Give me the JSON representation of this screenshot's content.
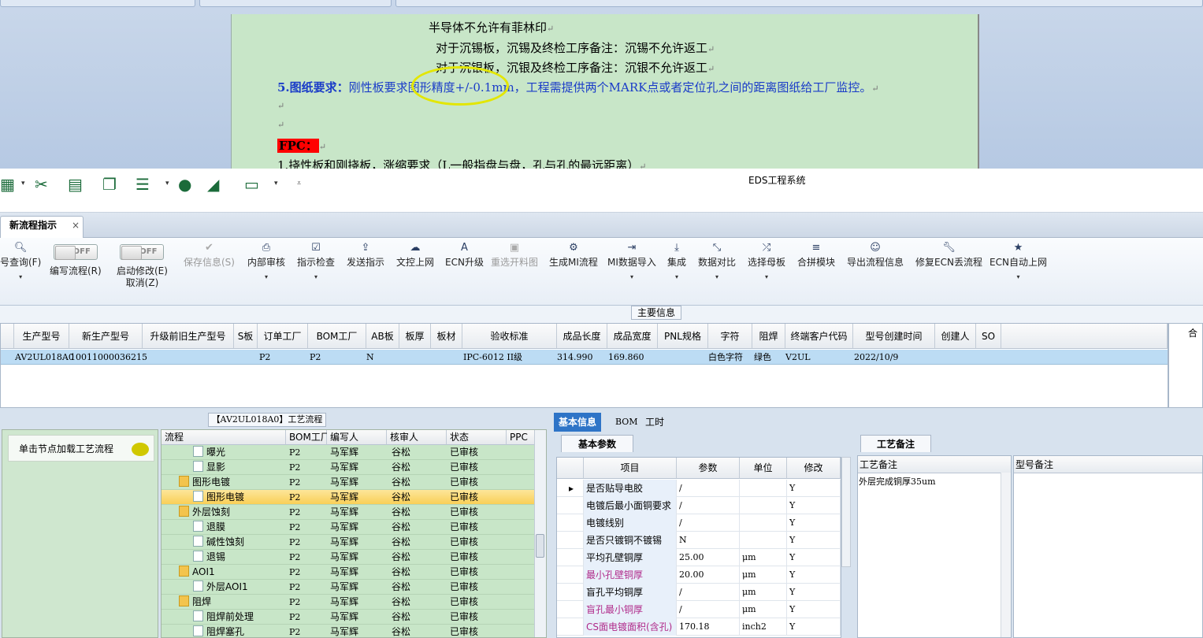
{
  "word": {
    "lines": [
      "半导体不允许有菲林印",
      "对于沉锡板，沉锡及终检工序备注：沉锡不允许返工",
      "对于沉银板，沉银及终检工序备注：沉银不允许返工"
    ],
    "req_label": "5.图纸要求：",
    "req_text": "刚性板要求图形精度+/-0.1mm，工程需提供两个MARK点或者定位孔之间的距离图纸给工厂监控。",
    "fpc": "FPC：",
    "fpc_line": "1.挠性板和刚挠板，涨缩要求（L一般指盘与盘，孔与孔的最远距离）"
  },
  "app": {
    "title": "EDS工程系统"
  },
  "tab": {
    "label": "新流程指示",
    "close": "×"
  },
  "ribbon": {
    "query": "号查询(F)",
    "edit_flow": "编写流程(R)",
    "start_modify": "启动修改(E)",
    "cancel": "取消(Z)",
    "toggle_off": "OFF",
    "save": "保存信息(S)",
    "internal_review": "内部审核",
    "instr_check": "指示检查",
    "send": "发送指示",
    "doc_upload": "文控上网",
    "ecn_upgrade": "ECN升级",
    "reselect_img": "重选开料图",
    "gen_mi": "生成MI流程",
    "mi_import": "MI数据导入",
    "integrate": "集成",
    "compare": "数据对比",
    "choose_board": "选择母板",
    "merge_module": "合拼模块",
    "export_info": "导出流程信息",
    "fix_ecn": "修复ECN丢流程",
    "ecn_auto": "ECN自动上网"
  },
  "main_info": {
    "label": "主要信息",
    "columns": [
      "生产型号",
      "新生产型号",
      "升级前旧生产型号",
      "S板",
      "订单工厂",
      "BOM工厂",
      "AB板",
      "板厚",
      "板材",
      "验收标准",
      "成品长度",
      "成品宽度",
      "PNL规格",
      "字符",
      "阻焊",
      "终端客户代码",
      "型号创建时间",
      "创建人",
      "SO"
    ],
    "row": {
      "c0": "AV2UL018A0",
      "c1": "10011000036215",
      "c4": "P2",
      "c5": "P2",
      "c6": "N",
      "c9": "IPC-6012 II级",
      "c10": "314.990",
      "c11": "169.860",
      "c13": "白色字符",
      "c14": "绿色",
      "c15": "V2UL",
      "c16": "2022/10/9"
    },
    "right_header": "合"
  },
  "process": {
    "title": "【AV2UL018A0】工艺流程",
    "node_hint": "单击节点加载工艺流程",
    "columns": [
      "流程",
      "BOM工厂",
      "编写人",
      "核审人",
      "状态",
      "PPC"
    ],
    "rows": [
      {
        "name": "曝光",
        "type": "doc",
        "indent": 2,
        "bom": "P2",
        "writer": "马军辉",
        "reviewer": "谷松",
        "status": "已审核"
      },
      {
        "name": "显影",
        "type": "doc",
        "indent": 2,
        "bom": "P2",
        "writer": "马军辉",
        "reviewer": "谷松",
        "status": "已审核"
      },
      {
        "name": "图形电镀",
        "type": "folder",
        "indent": 1,
        "bom": "P2",
        "writer": "马军辉",
        "reviewer": "谷松",
        "status": "已审核"
      },
      {
        "name": "图形电镀",
        "type": "doc",
        "indent": 2,
        "bom": "P2",
        "writer": "马军辉",
        "reviewer": "谷松",
        "status": "已审核",
        "selected": true
      },
      {
        "name": "外层蚀刻",
        "type": "folder",
        "indent": 1,
        "bom": "P2",
        "writer": "马军辉",
        "reviewer": "谷松",
        "status": "已审核"
      },
      {
        "name": "退膜",
        "type": "doc",
        "indent": 2,
        "bom": "P2",
        "writer": "马军辉",
        "reviewer": "谷松",
        "status": "已审核"
      },
      {
        "name": "碱性蚀刻",
        "type": "doc",
        "indent": 2,
        "bom": "P2",
        "writer": "马军辉",
        "reviewer": "谷松",
        "status": "已审核"
      },
      {
        "name": "退锡",
        "type": "doc",
        "indent": 2,
        "bom": "P2",
        "writer": "马军辉",
        "reviewer": "谷松",
        "status": "已审核"
      },
      {
        "name": "AOI1",
        "type": "folder",
        "indent": 1,
        "bom": "P2",
        "writer": "马军辉",
        "reviewer": "谷松",
        "status": "已审核"
      },
      {
        "name": "外层AOI1",
        "type": "doc",
        "indent": 2,
        "bom": "P2",
        "writer": "马军辉",
        "reviewer": "谷松",
        "status": "已审核"
      },
      {
        "name": "阻焊",
        "type": "folder",
        "indent": 1,
        "bom": "P2",
        "writer": "马军辉",
        "reviewer": "谷松",
        "status": "已审核"
      },
      {
        "name": "阻焊前处理",
        "type": "doc",
        "indent": 2,
        "bom": "P2",
        "writer": "马军辉",
        "reviewer": "谷松",
        "status": "已审核"
      },
      {
        "name": "阻焊塞孔",
        "type": "doc",
        "indent": 2,
        "bom": "P2",
        "writer": "马军辉",
        "reviewer": "谷松",
        "status": "已审核"
      }
    ]
  },
  "basic": {
    "tabs": [
      "基本信息",
      "BOM",
      "工时"
    ],
    "section": "基本参数",
    "columns": [
      "项目",
      "参数",
      "单位",
      "修改"
    ],
    "rows": [
      {
        "item": "是否贴导电胶",
        "value": "/",
        "unit": "",
        "mod": "Y",
        "pink": false
      },
      {
        "item": "电镀后最小面铜要求",
        "value": "/",
        "unit": "",
        "mod": "Y",
        "pink": false
      },
      {
        "item": "电镀线别",
        "value": "/",
        "unit": "",
        "mod": "Y",
        "pink": false
      },
      {
        "item": "是否只镀铜不镀锡",
        "value": "N",
        "unit": "",
        "mod": "Y",
        "pink": false
      },
      {
        "item": "平均孔壁铜厚",
        "value": "25.00",
        "unit": "μm",
        "mod": "Y",
        "pink": false
      },
      {
        "item": "最小孔壁铜厚",
        "value": "20.00",
        "unit": "μm",
        "mod": "Y",
        "pink": true
      },
      {
        "item": "盲孔平均铜厚",
        "value": "/",
        "unit": "μm",
        "mod": "Y",
        "pink": false
      },
      {
        "item": "盲孔最小铜厚",
        "value": "/",
        "unit": "μm",
        "mod": "Y",
        "pink": true
      },
      {
        "item": "CS面电镀面积(含孔)",
        "value": "170.18",
        "unit": "inch2",
        "mod": "Y",
        "pink": true
      }
    ]
  },
  "notes": {
    "tab": "工艺备注",
    "col1": "工艺备注",
    "col2": "型号备注",
    "text": "外层完成铜厚35um"
  }
}
